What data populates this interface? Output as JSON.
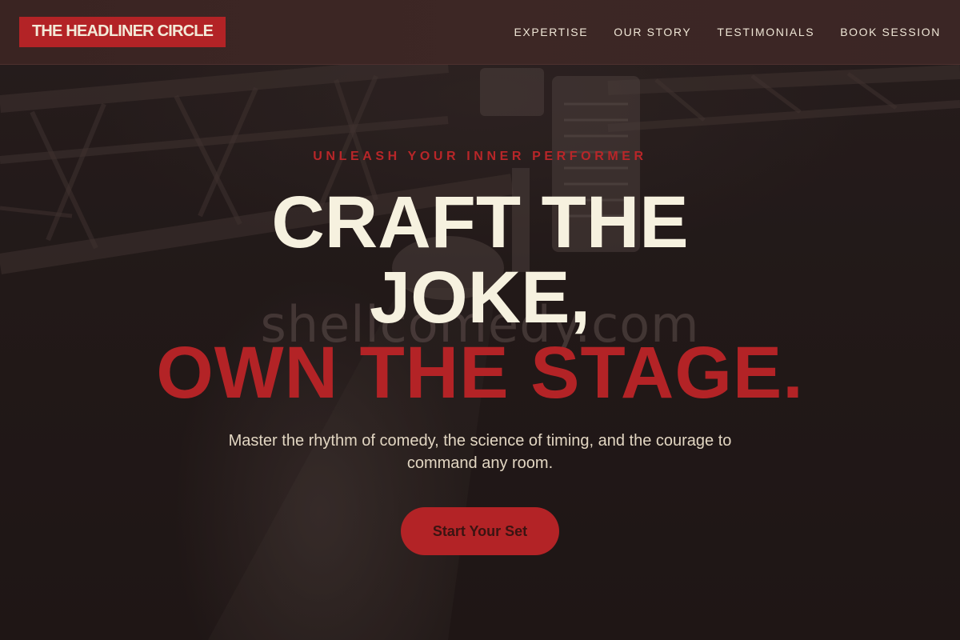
{
  "header": {
    "logo_text": "THE HEADLINER CIRCLE",
    "nav": [
      {
        "label": "EXPERTISE"
      },
      {
        "label": "OUR STORY"
      },
      {
        "label": "TESTIMONIALS"
      },
      {
        "label": "BOOK SESSION"
      }
    ]
  },
  "hero": {
    "eyebrow": "UNLEASH YOUR INNER PERFORMER",
    "headline_line1": "CRAFT THE",
    "headline_line2": "JOKE,",
    "headline_line3": "OWN THE STAGE.",
    "watermark": "shellcomedy.com",
    "subtitle": "Master the rhythm of comedy, the science of timing, and the courage to command any room.",
    "cta_label": "Start Your Set"
  },
  "colors": {
    "accent": "#b32326",
    "cream": "#f6f1df",
    "header_bg": "#3b2625",
    "background": "#231a19"
  }
}
